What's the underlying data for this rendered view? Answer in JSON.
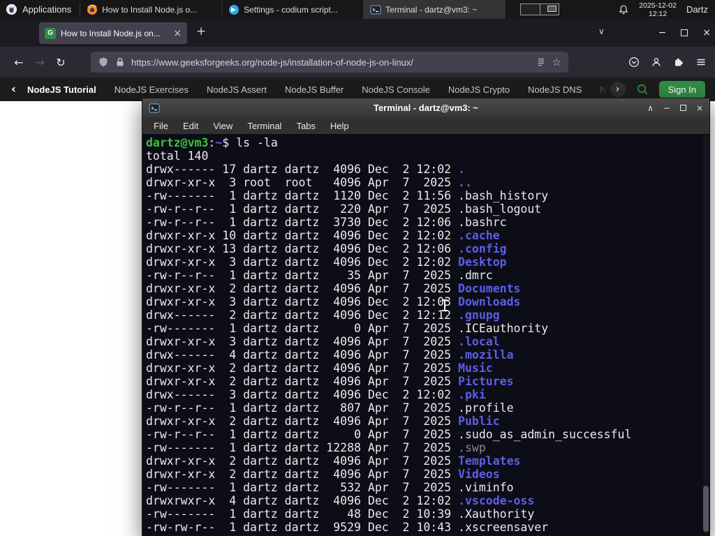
{
  "colors": {
    "gfg_green": "#2f8d46",
    "dir_blue": "#5a5ee8",
    "prompt_green": "#3cc13c",
    "dim_gray": "#8a8a8a",
    "terminal_bg": "#0d0d18",
    "panel_bg": "#171717",
    "firefox_tabbar": "#1c1b22",
    "firefox_toolbar": "#2b2a33",
    "firefox_field": "#42414d"
  },
  "glyphs": {
    "close": "×",
    "minus": "−",
    "plus": "+",
    "chevron_down": "∨",
    "chevron_up": "∧",
    "back_arrow": "←",
    "forward_arrow": "→",
    "reload": "↻",
    "star": "☆",
    "chevron_left": "‹",
    "chevron_right": "›",
    "favicon_letter": "G"
  },
  "panel": {
    "applications_label": "Applications",
    "tasks": [
      {
        "title": "How to Install Node.js o...",
        "icon": "firefox"
      },
      {
        "title": "Settings - codium script...",
        "icon": "codium"
      },
      {
        "title": "Terminal - dartz@vm3: ~",
        "icon": "terminal"
      }
    ],
    "clock": {
      "date": "2025-12-02",
      "time": "12:12"
    },
    "user": "Dartz"
  },
  "browser": {
    "tab_title": "How to Install Node.js on...",
    "url": "https://www.geeksforgeeks.org/node-js/installation-of-node-js-on-linux/"
  },
  "gfg": {
    "items": [
      "NodeJS Tutorial",
      "NodeJS Exercises",
      "NodeJS Assert",
      "NodeJS Buffer",
      "NodeJS Console",
      "NodeJS Crypto",
      "NodeJS DNS",
      "Node"
    ],
    "sign_in": "Sign In"
  },
  "terminal": {
    "title": "Terminal - dartz@vm3: ~",
    "menu": [
      "File",
      "Edit",
      "View",
      "Terminal",
      "Tabs",
      "Help"
    ],
    "prompt_user": "dartz@vm3",
    "prompt_sep": ":",
    "prompt_cwd": "~",
    "prompt_symbol": "$ ",
    "command": "ls -la",
    "total_line": "total 140",
    "listing": [
      {
        "meta": "drwx------ 17 dartz dartz  4096 Dec  2 12:02 ",
        "name": ".",
        "kind": "dir"
      },
      {
        "meta": "drwxr-xr-x  3 root  root   4096 Apr  7  2025 ",
        "name": "..",
        "kind": "dir"
      },
      {
        "meta": "-rw-------  1 dartz dartz  1120 Dec  2 11:56 ",
        "name": ".bash_history",
        "kind": "file"
      },
      {
        "meta": "-rw-r--r--  1 dartz dartz   220 Apr  7  2025 ",
        "name": ".bash_logout",
        "kind": "file"
      },
      {
        "meta": "-rw-r--r--  1 dartz dartz  3730 Dec  2 12:06 ",
        "name": ".bashrc",
        "kind": "file"
      },
      {
        "meta": "drwxr-xr-x 10 dartz dartz  4096 Dec  2 12:02 ",
        "name": ".cache",
        "kind": "dir"
      },
      {
        "meta": "drwxr-xr-x 13 dartz dartz  4096 Dec  2 12:06 ",
        "name": ".config",
        "kind": "dir"
      },
      {
        "meta": "drwxr-xr-x  3 dartz dartz  4096 Dec  2 12:02 ",
        "name": "Desktop",
        "kind": "dir"
      },
      {
        "meta": "-rw-r--r--  1 dartz dartz    35 Apr  7  2025 ",
        "name": ".dmrc",
        "kind": "file"
      },
      {
        "meta": "drwxr-xr-x  2 dartz dartz  4096 Apr  7  2025 ",
        "name": "Documents",
        "kind": "dir"
      },
      {
        "meta": "drwxr-xr-x  3 dartz dartz  4096 Dec  2 12:03 ",
        "name": "Downloads",
        "kind": "dir"
      },
      {
        "meta": "drwx------  2 dartz dartz  4096 Dec  2 12:12 ",
        "name": ".gnupg",
        "kind": "dir"
      },
      {
        "meta": "-rw-------  1 dartz dartz     0 Apr  7  2025 ",
        "name": ".ICEauthority",
        "kind": "file"
      },
      {
        "meta": "drwxr-xr-x  3 dartz dartz  4096 Apr  7  2025 ",
        "name": ".local",
        "kind": "dir"
      },
      {
        "meta": "drwx------  4 dartz dartz  4096 Apr  7  2025 ",
        "name": ".mozilla",
        "kind": "dir"
      },
      {
        "meta": "drwxr-xr-x  2 dartz dartz  4096 Apr  7  2025 ",
        "name": "Music",
        "kind": "dir"
      },
      {
        "meta": "drwxr-xr-x  2 dartz dartz  4096 Apr  7  2025 ",
        "name": "Pictures",
        "kind": "dir"
      },
      {
        "meta": "drwx------  3 dartz dartz  4096 Dec  2 12:02 ",
        "name": ".pki",
        "kind": "dir"
      },
      {
        "meta": "-rw-r--r--  1 dartz dartz   807 Apr  7  2025 ",
        "name": ".profile",
        "kind": "file"
      },
      {
        "meta": "drwxr-xr-x  2 dartz dartz  4096 Apr  7  2025 ",
        "name": "Public",
        "kind": "dir"
      },
      {
        "meta": "-rw-r--r--  1 dartz dartz     0 Apr  7  2025 ",
        "name": ".sudo_as_admin_successful",
        "kind": "file"
      },
      {
        "meta": "-rw-------  1 dartz dartz 12288 Apr  7  2025 ",
        "name": ".swp",
        "kind": "dim"
      },
      {
        "meta": "drwxr-xr-x  2 dartz dartz  4096 Apr  7  2025 ",
        "name": "Templates",
        "kind": "dir"
      },
      {
        "meta": "drwxr-xr-x  2 dartz dartz  4096 Apr  7  2025 ",
        "name": "Videos",
        "kind": "dir"
      },
      {
        "meta": "-rw-------  1 dartz dartz   532 Apr  7  2025 ",
        "name": ".viminfo",
        "kind": "file"
      },
      {
        "meta": "drwxrwxr-x  4 dartz dartz  4096 Dec  2 12:02 ",
        "name": ".vscode-oss",
        "kind": "dir"
      },
      {
        "meta": "-rw-------  1 dartz dartz    48 Dec  2 10:39 ",
        "name": ".Xauthority",
        "kind": "file"
      },
      {
        "meta": "-rw-rw-r--  1 dartz dartz  9529 Dec  2 10:43 ",
        "name": ".xscreensaver",
        "kind": "file"
      }
    ]
  }
}
